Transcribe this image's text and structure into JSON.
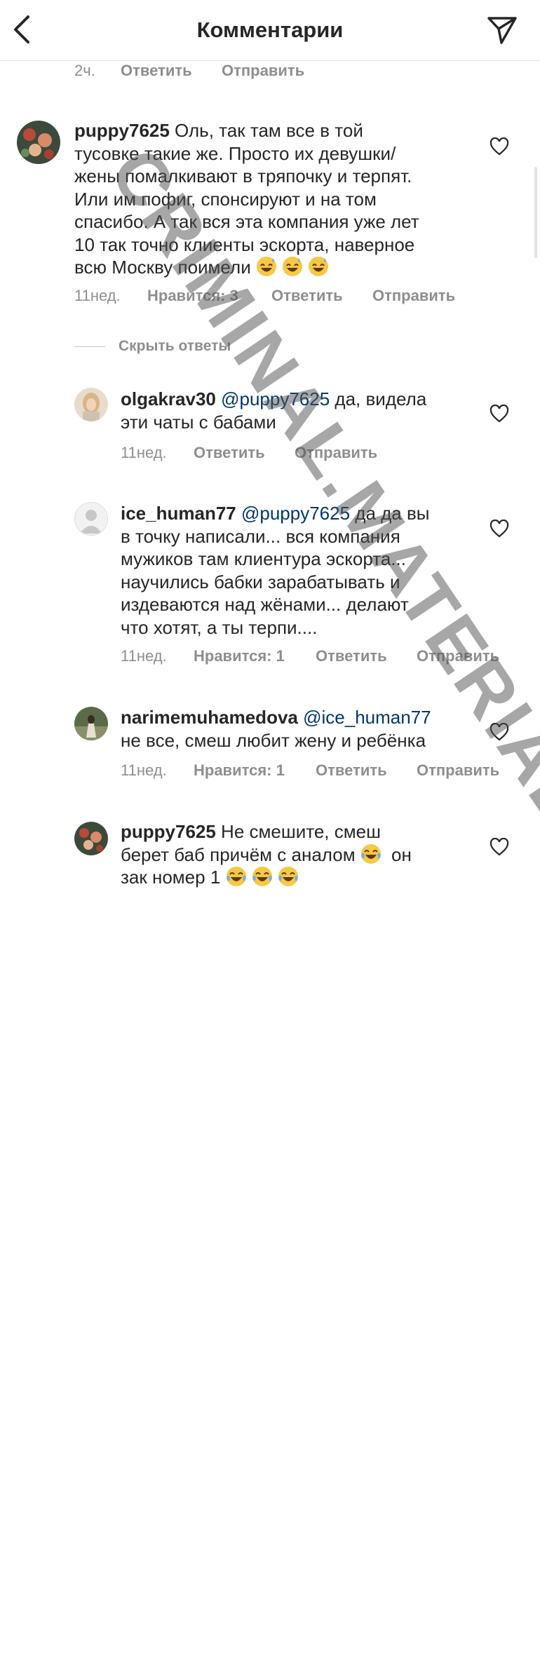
{
  "header": {
    "title": "Комментарии"
  },
  "top_meta": {
    "time": "2ч.",
    "reply": "Ответить",
    "send": "Отправить"
  },
  "comments": [
    {
      "user": "puppy7625",
      "mention": "",
      "lines": [
        " Оль, так там все в той",
        "тусовке такие же. Просто их девушки/",
        "жены помалкивают в тряпочку и терпят.",
        "Или им пофиг, спонсируют и на том",
        "спасибо. А так вся эта компания уже лет",
        "10 так точно клиенты эскорта, наверное",
        "всю Москву поимели "
      ],
      "emojis": [
        "sweat-smile",
        "sweat-smile",
        "sweat-smile"
      ],
      "meta": {
        "time": "11нед.",
        "likes": "Нравится: 3",
        "reply": "Ответить",
        "send": "Отправить"
      }
    },
    {
      "user": "olgakrav30",
      "mention": "@puppy7625",
      "lines": [
        " да, видела",
        "эти чаты с бабами"
      ],
      "meta": {
        "time": "11нед.",
        "reply": "Ответить",
        "send": "Отправить"
      }
    },
    {
      "user": "ice_human77",
      "mention": "@puppy7625",
      "lines": [
        " да да вы",
        "в точку написали... вся компания",
        "мужиков там клиентура эскорта...",
        "научились бабки зарабатывать и",
        "издеваются над жёнами... делают",
        "что хотят, а ты терпи...."
      ],
      "meta": {
        "time": "11нед.",
        "likes": "Нравится: 1",
        "reply": "Ответить",
        "send": "Отправить"
      }
    },
    {
      "user": "narimemuhamedova",
      "mention": "@ice_human77",
      "lines": [
        "",
        "не все, смеш любит жену и ребёнка"
      ],
      "meta": {
        "time": "11нед.",
        "likes": "Нравится: 1",
        "reply": "Ответить",
        "send": "Отправить"
      }
    },
    {
      "user": "puppy7625",
      "mention": "",
      "lines": [
        " Не смешите, смеш",
        "берет баб причём с аналом ",
        " он",
        "зак номер 1 "
      ],
      "emojis": [
        "joy",
        "joy",
        "joy",
        "joy"
      ]
    }
  ],
  "replies_toggle": "Скрыть ответы",
  "watermark": "CRIMINAL.MATERIALS WWW.RUCRIMINAL.INFO",
  "colors": {
    "text": "#262626",
    "secondary": "#8e8e8e",
    "mention": "#00376b",
    "emoji": "#f7c843"
  }
}
